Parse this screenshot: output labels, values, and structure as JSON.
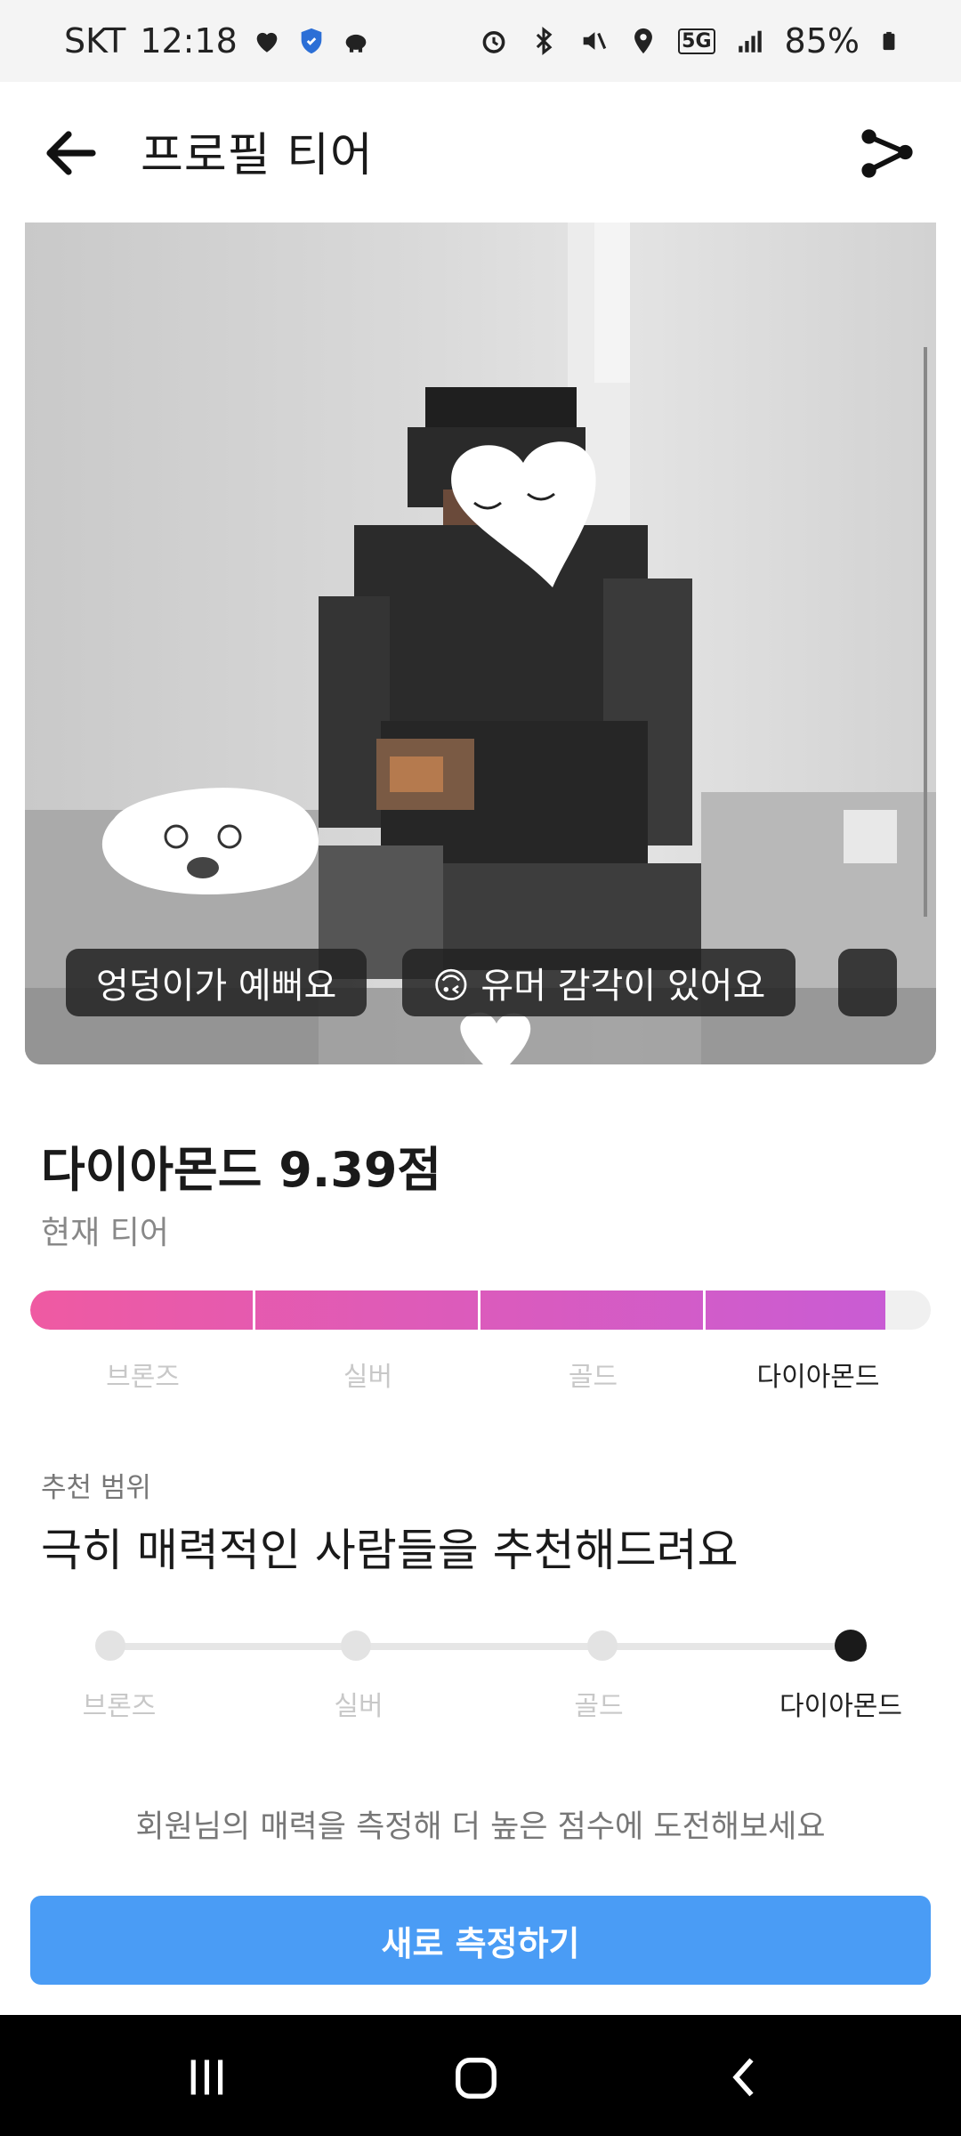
{
  "status_bar": {
    "carrier": "SKT",
    "time": "12:18",
    "battery": "85%",
    "network": "5G",
    "left_icons": [
      "heart-icon",
      "shield-icon",
      "piggy-bank-icon"
    ],
    "right_icons": [
      "alarm-icon",
      "bluetooth-icon",
      "mute-icon",
      "location-icon",
      "signal-icon",
      "battery-icon"
    ]
  },
  "app_bar": {
    "title": "프로필 티어",
    "back_icon": "arrow-left-icon",
    "share_icon": "share-icon"
  },
  "photo": {
    "chips": [
      {
        "label": "엉덩이가 예뻐요"
      },
      {
        "label": "🙃 유머 감각이 있어요"
      },
      {
        "label": ""
      }
    ]
  },
  "tier": {
    "score_text": "다이아몬드 9.39점",
    "current_label": "현재 티어",
    "progress_fraction": 0.95,
    "levels": [
      "브론즈",
      "실버",
      "골드",
      "다이아몬드"
    ],
    "active_index": 3,
    "fill_color_start": "#ef5aa2",
    "fill_color_end": "#c95cd4"
  },
  "recommend": {
    "label": "추천 범위",
    "text": "극히 매력적인 사람들을 추천해드려요",
    "levels": [
      "브론즈",
      "실버",
      "골드",
      "다이아몬드"
    ],
    "active_index": 3
  },
  "footer": {
    "prompt": "회원님의 매력을 측정해 더 높은 점수에 도전해보세요",
    "cta_label": "새로 측정하기",
    "cta_color": "#4a9cf5"
  },
  "nav_bar": {
    "icons": [
      "recent-apps-icon",
      "home-icon",
      "back-nav-icon"
    ]
  }
}
